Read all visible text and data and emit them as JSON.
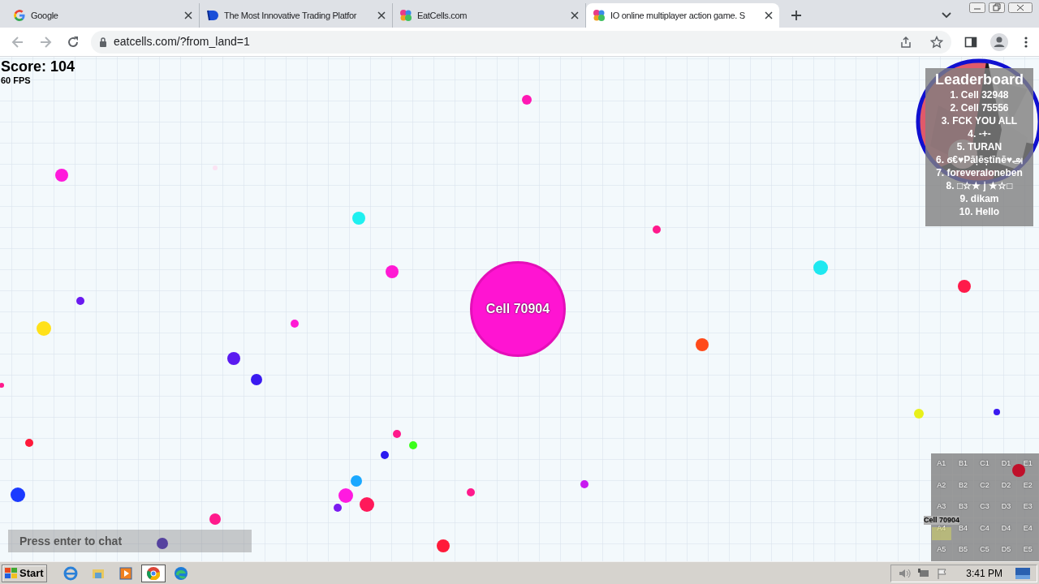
{
  "tabs": [
    {
      "title": "Google",
      "selected": false
    },
    {
      "title": "The Most Innovative Trading Platfor",
      "selected": false
    },
    {
      "title": "EatCells.com",
      "selected": false
    },
    {
      "title": "IO online multiplayer action game. S",
      "selected": true
    }
  ],
  "address": "eatcells.com/?from_land=1",
  "game": {
    "score": "Score: 104",
    "fps": "60 FPS",
    "player_name": "Cell 70904",
    "leaderboard": {
      "title": "Leaderboard",
      "entries": [
        "1. Cell 32948",
        "2. Cell 75556",
        "3. FCK YOU ALL",
        "4. -+-",
        "5. TURAN",
        "6. ϭ€♥Pāļēștīnē♥அ",
        "7. foreveraloneben",
        "8. □☆★ j ★☆□",
        "9. dikam",
        "10. Hello"
      ]
    },
    "minimap": {
      "cells": [
        "A1",
        "B1",
        "C1",
        "D1",
        "E1",
        "A2",
        "B2",
        "C2",
        "D2",
        "E2",
        "A3",
        "B3",
        "C3",
        "D3",
        "E3",
        "A4",
        "B4",
        "C4",
        "D4",
        "E4",
        "A5",
        "B5",
        "C5",
        "D5",
        "E5"
      ],
      "player_label": "Cell 70904"
    },
    "chat": {
      "placeholder": "Press enter to chat"
    }
  },
  "taskbar": {
    "start": "Start",
    "clock": "3:41 PM"
  }
}
